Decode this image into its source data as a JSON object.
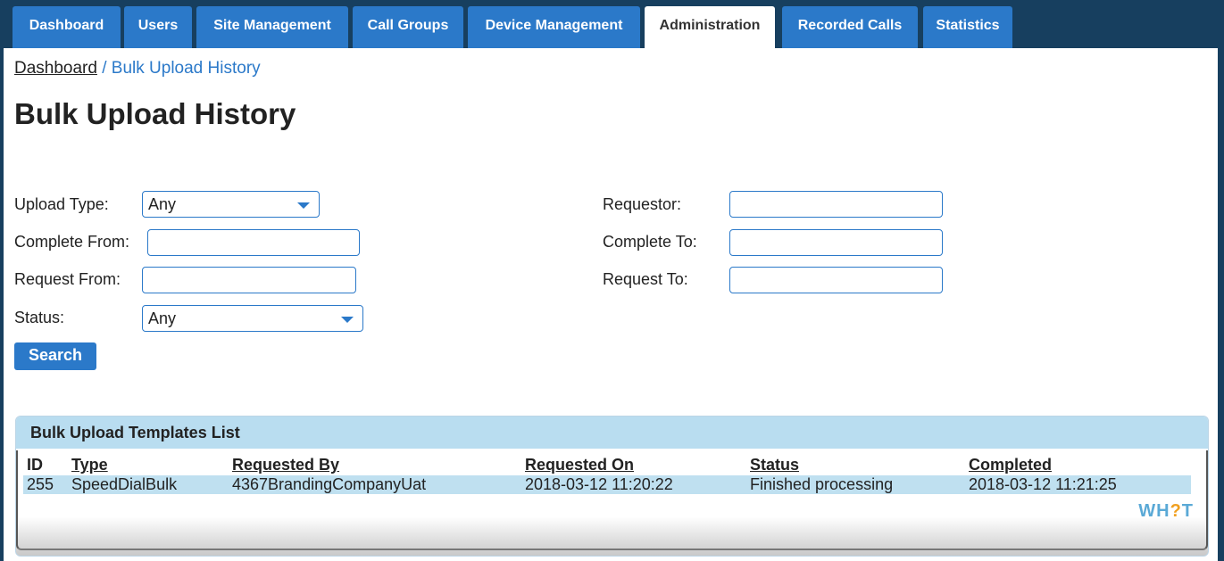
{
  "tabs": [
    {
      "label": "Dashboard",
      "active": false
    },
    {
      "label": "Users",
      "active": false
    },
    {
      "label": "Site Management",
      "active": false
    },
    {
      "label": "Call Groups",
      "active": false
    },
    {
      "label": "Device Management",
      "active": false
    },
    {
      "label": "Administration",
      "active": true
    },
    {
      "label": "Recorded Calls",
      "active": false
    },
    {
      "label": "Statistics",
      "active": false
    }
  ],
  "breadcrumb": {
    "home": "Dashboard",
    "separator": "/",
    "current": "Bulk Upload History"
  },
  "page_title": "Bulk Upload History",
  "filters": {
    "upload_type": {
      "label": "Upload Type:",
      "value": "Any"
    },
    "complete_from": {
      "label": "Complete From:",
      "value": ""
    },
    "request_from": {
      "label": "Request From:",
      "value": ""
    },
    "status": {
      "label": "Status:",
      "value": "Any"
    },
    "requestor": {
      "label": "Requestor:",
      "value": ""
    },
    "complete_to": {
      "label": "Complete To:",
      "value": ""
    },
    "request_to": {
      "label": "Request To:",
      "value": ""
    }
  },
  "search_button": "Search",
  "table": {
    "title": "Bulk Upload Templates List",
    "columns": [
      "ID",
      "Type",
      "Requested By",
      "Requested On",
      "Status",
      "Completed"
    ],
    "rows": [
      [
        "255",
        "SpeedDialBulk",
        "4367BrandingCompanyUat",
        "2018-03-12 11:20:22",
        "Finished processing",
        "2018-03-12 11:21:25"
      ]
    ]
  },
  "logo": {
    "part1": "WH",
    "part2": "?",
    "part3": "T"
  },
  "colors": {
    "accent": "#2b79c9",
    "background": "#173f5f",
    "panel_header": "#b9ddf0",
    "row_highlight": "#bfe0f0"
  }
}
